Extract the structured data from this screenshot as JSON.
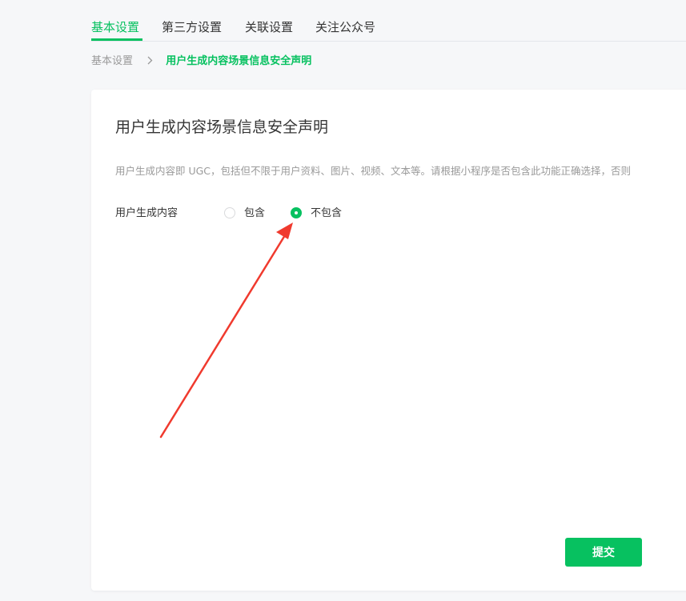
{
  "tabs": [
    {
      "label": "基本设置",
      "active": true
    },
    {
      "label": "第三方设置",
      "active": false
    },
    {
      "label": "关联设置",
      "active": false
    },
    {
      "label": "关注公众号",
      "active": false
    }
  ],
  "breadcrumb": {
    "parent": "基本设置",
    "separator_icon": "chevron-right-icon",
    "current": "用户生成内容场景信息安全声明"
  },
  "card": {
    "title": "用户生成内容场景信息安全声明",
    "description": "用户生成内容即 UGC，包括但不限于用户资料、图片、视频、文本等。请根据小程序是否包含此功能正确选择，否则",
    "field_label": "用户生成内容",
    "options": [
      {
        "label": "包含",
        "checked": false
      },
      {
        "label": "不包含",
        "checked": true
      }
    ],
    "submit_label": "提交"
  },
  "colors": {
    "accent": "#07c160",
    "annotation_arrow": "#f03a2e"
  }
}
